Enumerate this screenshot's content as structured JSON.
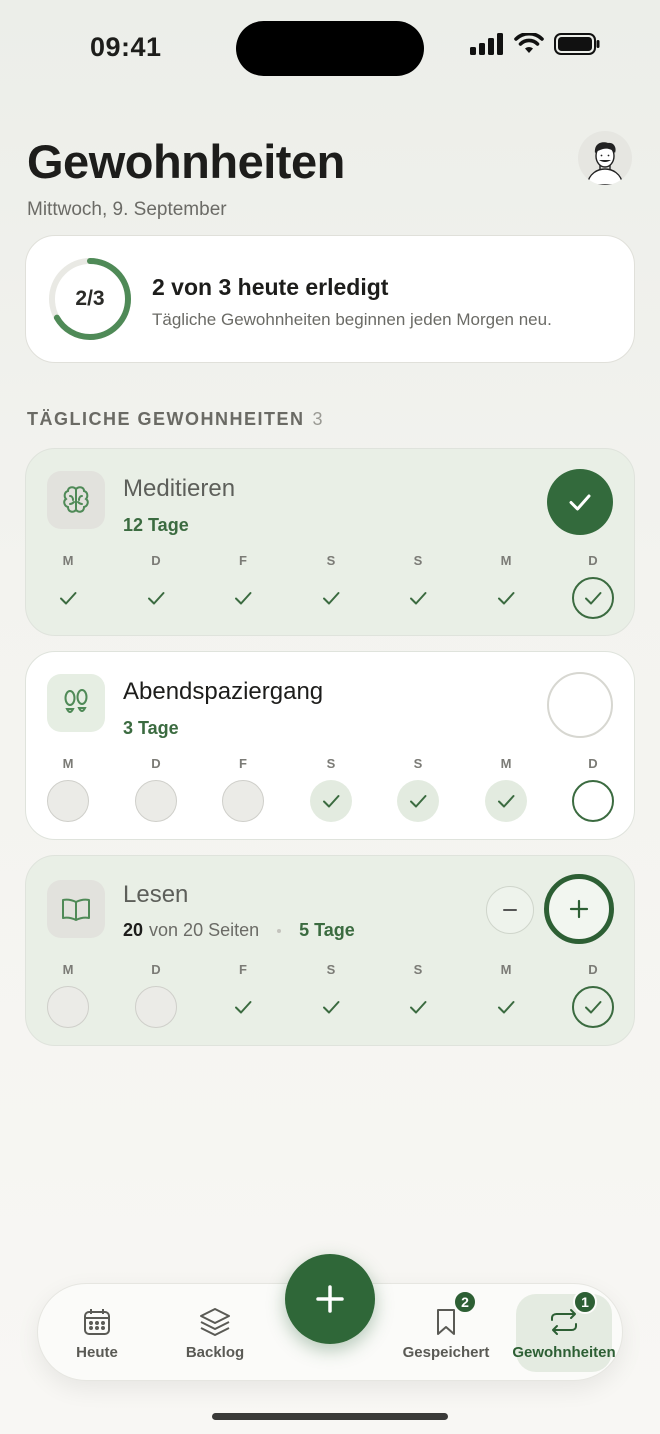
{
  "status_bar": {
    "time": "09:41"
  },
  "header": {
    "title": "Gewohnheiten",
    "date": "Mittwoch, 9. September"
  },
  "summary": {
    "ring_text": "2/3",
    "progress": 0.667,
    "title": "2 von 3 heute erledigt",
    "subtitle": "Tägliche Gewohnheiten beginnen jeden Morgen neu."
  },
  "section": {
    "label": "TÄGLICHE GEWOHNHEITEN",
    "count": "3"
  },
  "weekdays": [
    "M",
    "D",
    "F",
    "S",
    "S",
    "M",
    "D"
  ],
  "habits": [
    {
      "name": "Meditieren",
      "streak": "12 Tage",
      "icon": "brain-icon",
      "status": "done",
      "days": [
        "done",
        "done",
        "done",
        "done",
        "done",
        "done",
        "today-done"
      ]
    },
    {
      "name": "Abendspaziergang",
      "streak": "3 Tage",
      "icon": "footsteps-icon",
      "status": "open",
      "days": [
        "missed",
        "missed",
        "missed",
        "done",
        "done",
        "done",
        "today-open"
      ]
    },
    {
      "name": "Lesen",
      "pages_done": "20",
      "pages_text": "von 20 Seiten",
      "streak": "5 Tage",
      "icon": "book-icon",
      "status": "done",
      "days": [
        "missed",
        "missed",
        "done",
        "done",
        "done",
        "done",
        "today-done"
      ]
    }
  ],
  "tab_bar": {
    "items": [
      {
        "label": "Heute",
        "icon": "calendar-icon"
      },
      {
        "label": "Backlog",
        "icon": "layers-icon"
      },
      {
        "label": "Gespeichert",
        "icon": "bookmark-icon",
        "badge": "2"
      },
      {
        "label": "Gewohnheiten",
        "icon": "repeat-icon",
        "badge": "1",
        "active": true
      }
    ],
    "fab_icon": "plus-icon"
  },
  "colors": {
    "accent": "#2f6738",
    "done_card": "#e9efe6",
    "text_muted": "#6b6b66"
  }
}
